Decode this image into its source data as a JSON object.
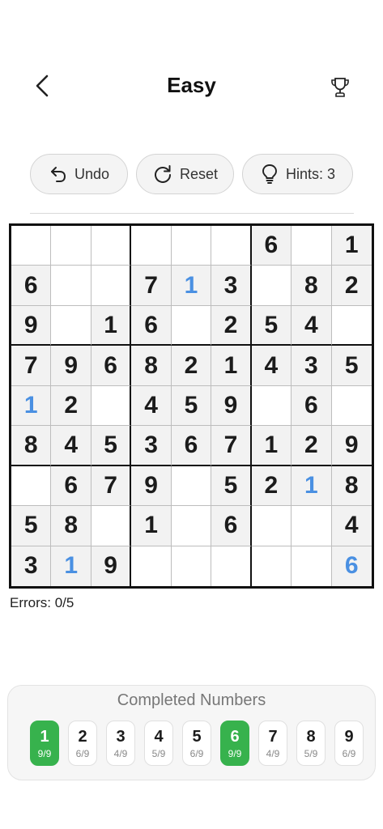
{
  "header": {
    "title": "Easy",
    "back_icon": "chevron-left-icon",
    "trophy_icon": "trophy-icon"
  },
  "actions": {
    "undo_label": "Undo",
    "reset_label": "Reset",
    "hints_label": "Hints: 3"
  },
  "grid": {
    "rows": [
      [
        "",
        "",
        "",
        "",
        "",
        "",
        "6",
        "",
        "1"
      ],
      [
        "6",
        "",
        "",
        "7",
        "1",
        "3",
        "",
        "8",
        "2"
      ],
      [
        "9",
        "",
        "1",
        "6",
        "",
        "2",
        "5",
        "4",
        ""
      ],
      [
        "7",
        "9",
        "6",
        "8",
        "2",
        "1",
        "4",
        "3",
        "5"
      ],
      [
        "1",
        "2",
        "",
        "4",
        "5",
        "9",
        "",
        "6",
        ""
      ],
      [
        "8",
        "4",
        "5",
        "3",
        "6",
        "7",
        "1",
        "2",
        "9"
      ],
      [
        "",
        "6",
        "7",
        "9",
        "",
        "5",
        "2",
        "1",
        "8"
      ],
      [
        "5",
        "8",
        "",
        "1",
        "",
        "6",
        "",
        "",
        "4"
      ],
      [
        "3",
        "1",
        "9",
        "",
        "",
        "",
        "",
        "",
        "6"
      ]
    ],
    "user_entries": [
      [
        1,
        4
      ],
      [
        4,
        0
      ],
      [
        6,
        7
      ],
      [
        8,
        1
      ],
      [
        8,
        8
      ]
    ],
    "colors": {
      "given": "#1b1b1b",
      "user": "#4a90e2",
      "given_bg": "#f2f2f2"
    }
  },
  "status": {
    "errors_text": "Errors: 0/5"
  },
  "completed": {
    "title": "Completed Numbers",
    "items": [
      {
        "number": "1",
        "count": "9/9",
        "complete": true
      },
      {
        "number": "2",
        "count": "6/9",
        "complete": false
      },
      {
        "number": "3",
        "count": "4/9",
        "complete": false
      },
      {
        "number": "4",
        "count": "5/9",
        "complete": false
      },
      {
        "number": "5",
        "count": "6/9",
        "complete": false
      },
      {
        "number": "6",
        "count": "9/9",
        "complete": true
      },
      {
        "number": "7",
        "count": "4/9",
        "complete": false
      },
      {
        "number": "8",
        "count": "5/9",
        "complete": false
      },
      {
        "number": "9",
        "count": "6/9",
        "complete": false
      }
    ],
    "complete_color": "#37b24d"
  }
}
